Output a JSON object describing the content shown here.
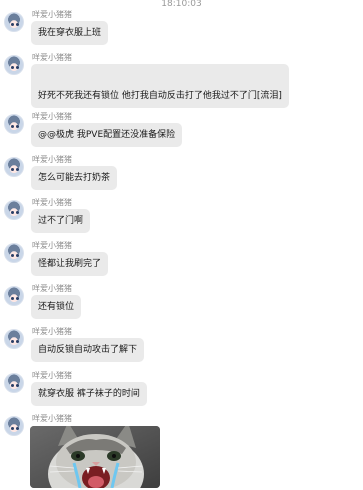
{
  "timestamp": "18:10:03",
  "sender_name": "咩爱小猪猪",
  "messages": [
    {
      "text": "我在穿衣服上班"
    },
    {
      "text": "好死不死我还有锁位 他打我自动反击打了他我过不了门[流泪]"
    },
    {
      "text": "@@极虎 我PVE配置还没准备保险"
    },
    {
      "text": "怎么可能去打奶茶"
    },
    {
      "text": "过不了门啊"
    },
    {
      "text": "怪都让我刷完了"
    },
    {
      "text": "还有锁位"
    },
    {
      "text": "自动反锁自动攻击了解下"
    },
    {
      "text": "就穿衣服 裤子袜子的时间"
    }
  ],
  "image_message": {
    "alt": "screaming cat photo"
  }
}
